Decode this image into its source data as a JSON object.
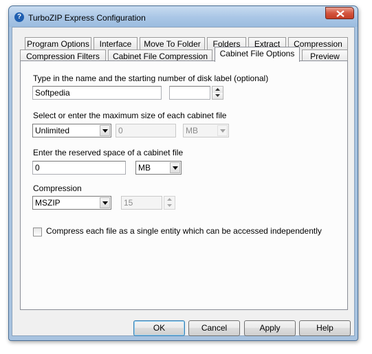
{
  "window": {
    "title": "TurboZIP Express Configuration",
    "app_icon_glyph": "?",
    "icons": {
      "app": "help-app-icon",
      "close": "close-icon"
    }
  },
  "tabs": {
    "row1": [
      "Program Options",
      "Interface",
      "Move To Folder",
      "Folders",
      "Extract",
      "Compression"
    ],
    "row2": [
      "Compression Filters",
      "Cabinet File Compression",
      "Cabinet File Options",
      "Preview"
    ],
    "active": "Cabinet File Options"
  },
  "panel": {
    "disk_label": {
      "label": "Type in the name and the starting number of disk label (optional)",
      "name_value": "Softpedia",
      "number_value": ""
    },
    "max_size": {
      "label": "Select or enter the maximum size of each cabinet file",
      "selected": "Unlimited",
      "size_value": "0",
      "unit": "MB"
    },
    "reserved": {
      "label": "Enter the reserved space of a cabinet file",
      "value": "0",
      "unit": "MB"
    },
    "compression": {
      "label": "Compression",
      "selected": "MSZIP",
      "level_value": "15"
    },
    "single_entity": {
      "label": "Compress each file as a single entity which can be accessed independently",
      "checked": false
    }
  },
  "buttons": {
    "ok": "OK",
    "cancel": "Cancel",
    "apply": "Apply",
    "help": "Help"
  },
  "colors": {
    "title_bar": "#a9c6e6",
    "close_button": "#d4563f",
    "default_button_border": "#3c7fb1"
  }
}
